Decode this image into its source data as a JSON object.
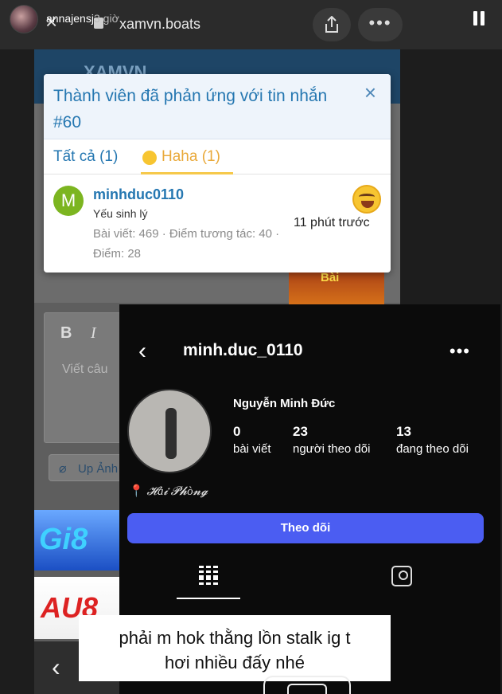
{
  "story": {
    "username": "annajensj",
    "time": "3 giờ"
  },
  "browser": {
    "url": "xamvn.boats"
  },
  "forum": {
    "logo": "XAMVN",
    "editor_placeholder": "Viết câu",
    "bold_label": "B",
    "italic_label": "I",
    "upload_label": "Up Ảnh",
    "ad_game_text": "Bài",
    "ad_gi8_text": "Gi8",
    "ad_au8_text": "AU8"
  },
  "modal": {
    "title": "Thành viên đã phản ứng với tin nhắn #60",
    "close": "×",
    "tabs": [
      {
        "label": "Tất cả (1)"
      },
      {
        "label": "Haha (1)"
      }
    ],
    "member": {
      "avatar_letter": "M",
      "name": "minhduc0110",
      "title": "Yếu sinh lý",
      "stats": "Bài viết: 469 · Điểm tương tác: 40 · Điểm: 28",
      "time": "11 phút trước",
      "reaction_icon": "laughing-tears-icon"
    }
  },
  "instagram": {
    "username": "minh.duc_0110",
    "full_name": "Nguyễn Minh Đức",
    "stats": [
      {
        "value": "0",
        "label": "bài viết"
      },
      {
        "value": "23",
        "label": "người theo dõi"
      },
      {
        "value": "13",
        "label": "đang theo dõi"
      }
    ],
    "location": "𝓗ả𝓲 𝓟𝓱ò𝓷𝓰",
    "follow_label": "Theo dõi",
    "follow_color": "#4b5df2"
  },
  "caption": {
    "line1": "phải m hok thằng lồn stalk ig t",
    "line2": "hơi nhiều đấy nhé"
  }
}
